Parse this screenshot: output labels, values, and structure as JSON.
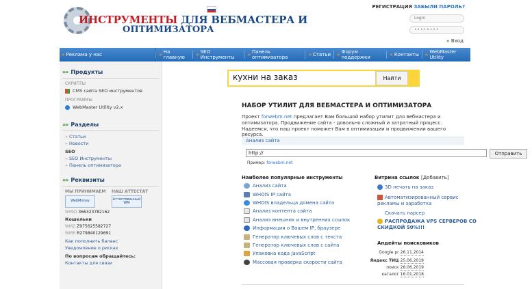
{
  "header": {
    "logo_line1_highlight": "ИНСТРУМЕНТЫ",
    "logo_line1_rest": " ДЛЯ ВЕБМАСТЕРА И",
    "logo_line2": "ОПТИМИЗАТОРА",
    "register_label": "РЕГИСТРАЦИЯ",
    "forgot_label": "ЗАБЫЛИ ПАРОЛЬ?",
    "login_placeholder": "Login",
    "password_value": "••••••••",
    "enter_label": "Вход"
  },
  "nav": {
    "ad_label": "Реклама у нас",
    "items": [
      {
        "label": "На главную"
      },
      {
        "label": "SEO Инструменты"
      },
      {
        "label": "Панель оптимизатора"
      },
      {
        "label": "Статьи"
      },
      {
        "label": "Форум поддержки"
      },
      {
        "label": "Контакты"
      },
      {
        "label": "WebMaster Utility"
      }
    ]
  },
  "sidebar": {
    "products": {
      "title": "Продукты",
      "scripts_caption": "СКРИПТЫ",
      "scripts_item": "CMS сайта SEO инструментов",
      "programs_caption": "ПРОГРАММЫ",
      "programs_item": "WebMaster Utility v2.x"
    },
    "sections": {
      "title": "Разделы",
      "links": [
        "Статьи",
        "Новости"
      ],
      "seo_label": "SEO",
      "seo_links": [
        "SEO Инструменты",
        "Панель оптимизатора"
      ]
    },
    "requisites": {
      "title": "Реквизиты",
      "accept_caption": "МЫ ПРИНИМАЕМ",
      "certificate_caption": "НАШ АТТЕСТАТ",
      "webmoney_badge": "WebMoney",
      "attest_badge": "Аттестованный WM",
      "wmid_label": "WMID",
      "wmid_value": "366323782162",
      "wallets_label": "Кошельки",
      "wmz_label": "WMZ",
      "wmz_value": "Z975625582727",
      "wmr_label": "WMR",
      "wmr_value": "R279840129691",
      "links": [
        "Как пополнить баланс",
        "Уведомление о рисках"
      ],
      "questions_label": "По вопросам обращайтесь:",
      "contact_link": "Контакты для связи"
    }
  },
  "main": {
    "search_value": "кухни на заказ",
    "search_button": "Найти",
    "title": "НАБОР УТИЛИТ ДЛЯ ВЕБМАСТЕРА И ОПТИМИЗАТОРА",
    "intro_prefix": "Проект ",
    "intro_link": "forwebm.net",
    "intro_rest": " предлагает Вам большой набор утилит для вебмастера и оптимизатора. Продвижение сайта - довольно сложный и затратный процесс. Надеемся, что наш проект поможет Вам в оптимизации и продвижении вашего ресурса.",
    "analyze_label": "Анализ сайта",
    "url_value": "http://",
    "check_button": "Отправить",
    "example_label": "Пример: ",
    "example_link": "forwebm.net",
    "tools_title": "Наиболее популярные инструменты",
    "tools": [
      {
        "label": "Анализ сайта",
        "icon": "magnifier-icon"
      },
      {
        "label": "WHOIS IP сайта",
        "icon": "whois-icon"
      },
      {
        "label": "WHOIS владельца домена сайта",
        "icon": "globe-icon"
      },
      {
        "label": "Анализ контента сайта",
        "icon": "document-icon"
      },
      {
        "label": "Анализ внешних и внутренних ссылок",
        "icon": "link-icon"
      },
      {
        "label": "Информация о Вашем IP, браузере",
        "icon": "info-icon"
      },
      {
        "label": "Генератор ключевых слов с текста",
        "icon": "pen-icon"
      },
      {
        "label": "Генератор ключевых слов с сайта",
        "icon": "pen-icon"
      },
      {
        "label": "Упаковка кода JavaScript",
        "icon": "package-icon"
      },
      {
        "label": "Массовая проверка скорости сайта",
        "icon": "speed-icon"
      }
    ],
    "links_title": "Витрина ссылок",
    "links_add": "[Добавить]",
    "links": [
      {
        "label": "3D печать на заказ"
      },
      {
        "label": "Автоматизированный сервис рекламы и заработка"
      },
      {
        "label": "Скачать парсер"
      },
      {
        "label": "РАСПРОДАЖА VPS СЕРВЕРОВ СО СКИДКОЙ 50%!!!"
      }
    ],
    "updates_title": "Апдейты поисковиков",
    "updates": [
      {
        "source": "Google pr",
        "date": "26.11.2014"
      },
      {
        "source": "Яндекс ТИЦ",
        "date": "25.06.2019"
      },
      {
        "source": "поиск",
        "date": "28.06.2019"
      },
      {
        "source": "каталог",
        "date": "16.01.2018"
      }
    ]
  },
  "colors": {
    "nav_blue": "#236bb6",
    "logo_red": "#c31b24",
    "logo_blue": "#1c4a86",
    "search_yellow": "#fcd53a",
    "arrow_green": "#2d8a2d"
  }
}
